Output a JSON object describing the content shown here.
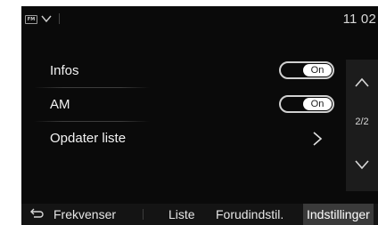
{
  "status": {
    "source_icon": "fm-radio-icon",
    "source_text": "FM",
    "time": "11 02"
  },
  "settings": {
    "rows": [
      {
        "label": "Infos",
        "control": "toggle",
        "value": "On"
      },
      {
        "label": "AM",
        "control": "toggle",
        "value": "On"
      },
      {
        "label": "Opdater liste",
        "control": "chevron-right-icon"
      }
    ]
  },
  "pager": {
    "indicator": "2/2",
    "up_icon": "chevron-up-icon",
    "down_icon": "chevron-down-icon"
  },
  "bottom_bar": {
    "back_icon": "back-arrow-icon",
    "tabs": [
      {
        "label": "Frekvenser",
        "active": false
      },
      {
        "label": "Liste",
        "active": false
      },
      {
        "label": "Forudindstil.",
        "active": false
      },
      {
        "label": "Indstillinger",
        "active": true
      }
    ]
  },
  "colors": {
    "background": "#0a0a0a",
    "active_tab": "#3a3a3a",
    "toggle_knob": "#ffffff"
  }
}
